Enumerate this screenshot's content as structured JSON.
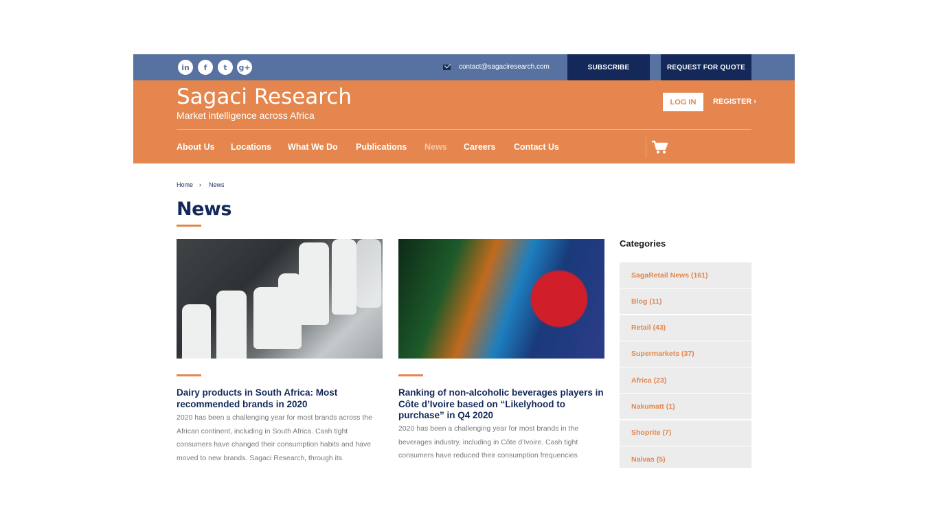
{
  "topbar": {
    "social": [
      {
        "name": "linkedin-icon",
        "glyph": "in"
      },
      {
        "name": "facebook-icon",
        "glyph": "f"
      },
      {
        "name": "twitter-icon",
        "glyph": "t"
      },
      {
        "name": "google-plus-icon",
        "glyph": "g+"
      }
    ],
    "contact_email": "contact@sagaciresearch.com",
    "subscribe_label": "SUBSCRIBE",
    "quote_label": "REQUEST FOR QUOTE"
  },
  "header": {
    "brand": "Sagaci Research",
    "tagline": "Market intelligence across Africa",
    "login_label": "LOG IN",
    "register_label": "REGISTER ›"
  },
  "nav": {
    "items": [
      {
        "label": "About Us",
        "active": false
      },
      {
        "label": "Locations",
        "active": false
      },
      {
        "label": "What We Do",
        "active": false
      },
      {
        "label": "Publications",
        "active": false
      },
      {
        "label": "News",
        "active": true
      },
      {
        "label": "Careers",
        "active": false
      },
      {
        "label": "Contact Us",
        "active": false
      }
    ]
  },
  "breadcrumb": {
    "home": "Home",
    "separator": "›",
    "current": "News"
  },
  "page": {
    "title": "News"
  },
  "posts": [
    {
      "title": "Dairy products in South Africa: Most recommended brands in 2020",
      "excerpt": "2020 has been a challenging year for most brands across the African continent, including in South Africa. Cash tight consumers have changed their consumption habits and have moved to new brands. Sagaci Research, through its"
    },
    {
      "title": "Ranking of non-alcoholic beverages players in Côte d’Ivoire based on “Likelyhood to purchase” in Q4 2020",
      "excerpt": "2020 has been a challenging year for most brands in the beverages industry, including in Côte d’Ivoire. Cash tight consumers have reduced their consumption frequencies"
    }
  ],
  "sidebar": {
    "heading": "Categories",
    "categories": [
      "SagaRetail News (161)",
      "Blog (11)",
      "Retail (43)",
      "Supermarkets (37)",
      "Africa (23)",
      "Nakumatt (1)",
      "Shoprite (7)",
      "Naivas (5)"
    ]
  },
  "colors": {
    "topbar": "#5772a0",
    "header": "#e4864d",
    "dark_button": "#14285a",
    "accent": "#e4864d",
    "heading": "#14285a"
  }
}
